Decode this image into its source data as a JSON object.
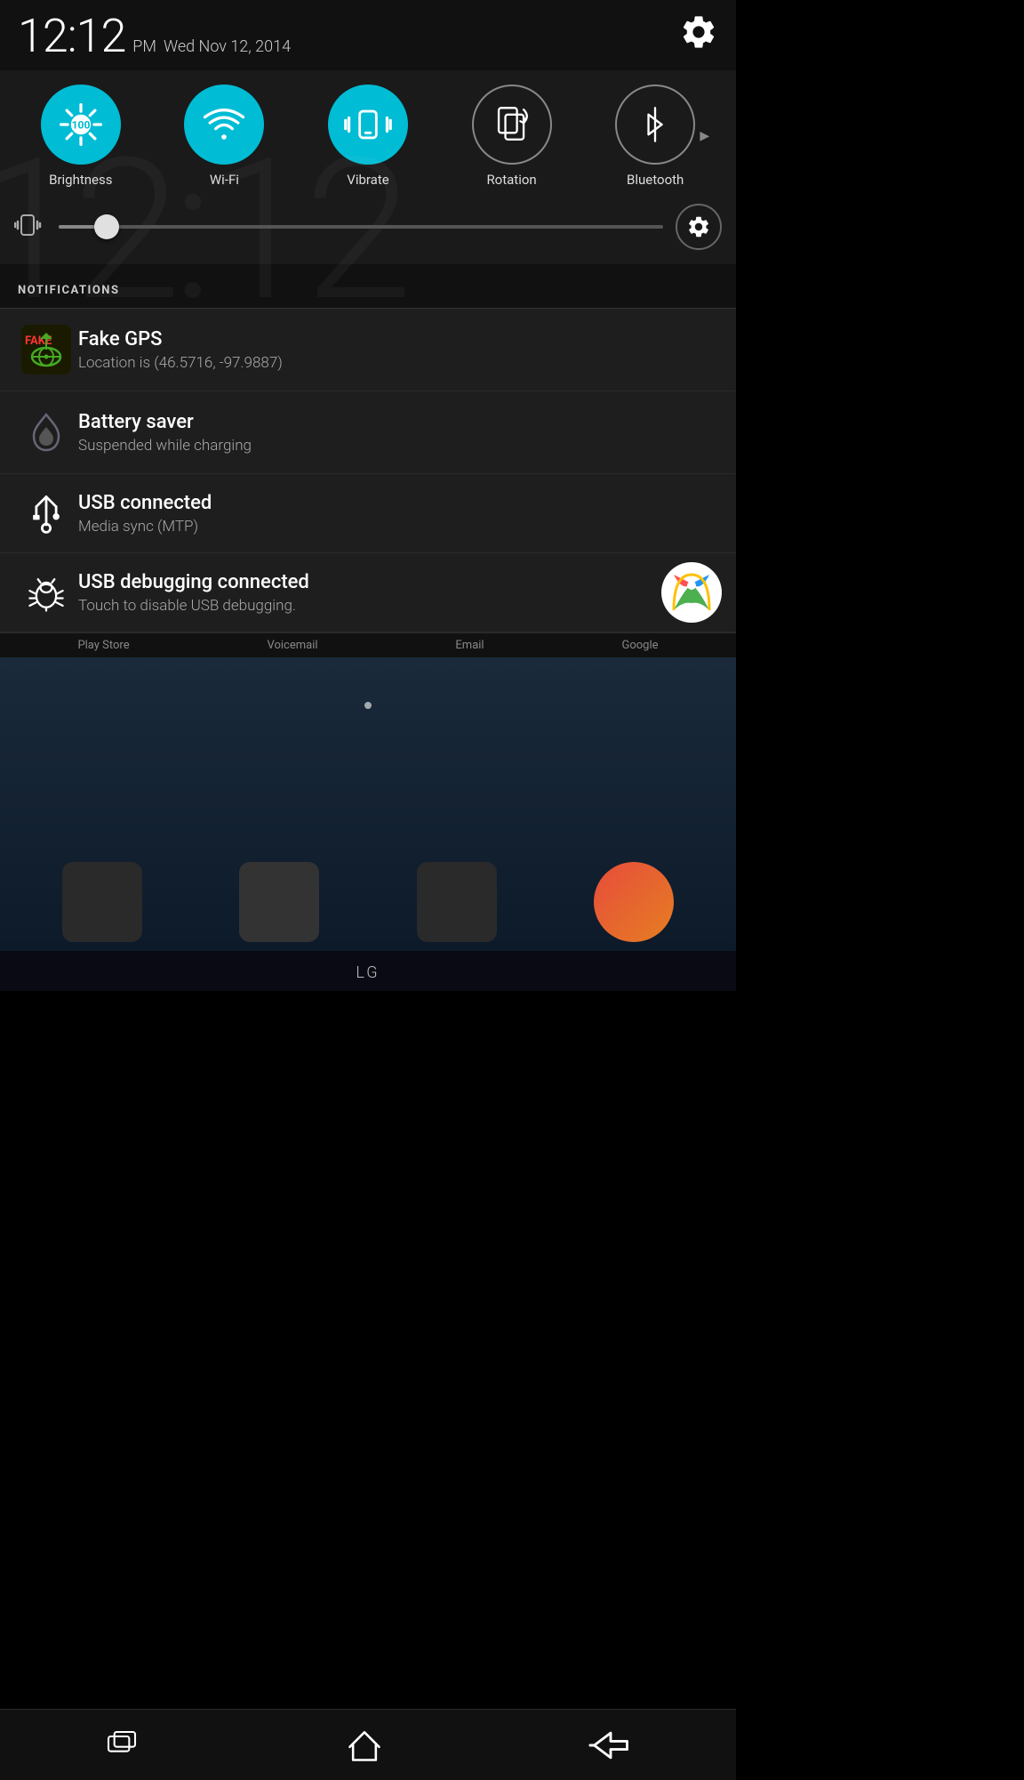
{
  "statusBar": {
    "time": "12:12",
    "ampm": "PM",
    "date": "Wed Nov 12, 2014"
  },
  "toggles": [
    {
      "id": "brightness",
      "label": "Brightness",
      "active": true,
      "value": "100"
    },
    {
      "id": "wifi",
      "label": "Wi-Fi",
      "active": true
    },
    {
      "id": "vibrate",
      "label": "Vibrate",
      "active": true
    },
    {
      "id": "rotation",
      "label": "Rotation",
      "active": false
    },
    {
      "id": "bluetooth",
      "label": "Bluetooth",
      "active": false
    }
  ],
  "slider": {
    "iconLabel": "vibrate-phone"
  },
  "notificationsTitle": "NOTIFICATIONS",
  "notifications": [
    {
      "id": "fake-gps",
      "title": "Fake GPS",
      "subtitle": "Location is (46.5716, -97.9887)"
    },
    {
      "id": "battery-saver",
      "title": "Battery saver",
      "subtitle": "Suspended while charging"
    },
    {
      "id": "usb-connected",
      "title": "USB connected",
      "subtitle": "Media sync (MTP)"
    },
    {
      "id": "usb-debug",
      "title": "USB debugging connected",
      "subtitle": "Touch to disable USB debugging."
    }
  ],
  "brandName": "LG",
  "appLabels": [
    "Play Store",
    "Voicemail",
    "Email",
    "Google"
  ],
  "navBar": {
    "recentLabel": "recent-apps",
    "homeLabel": "home",
    "backLabel": "back"
  }
}
